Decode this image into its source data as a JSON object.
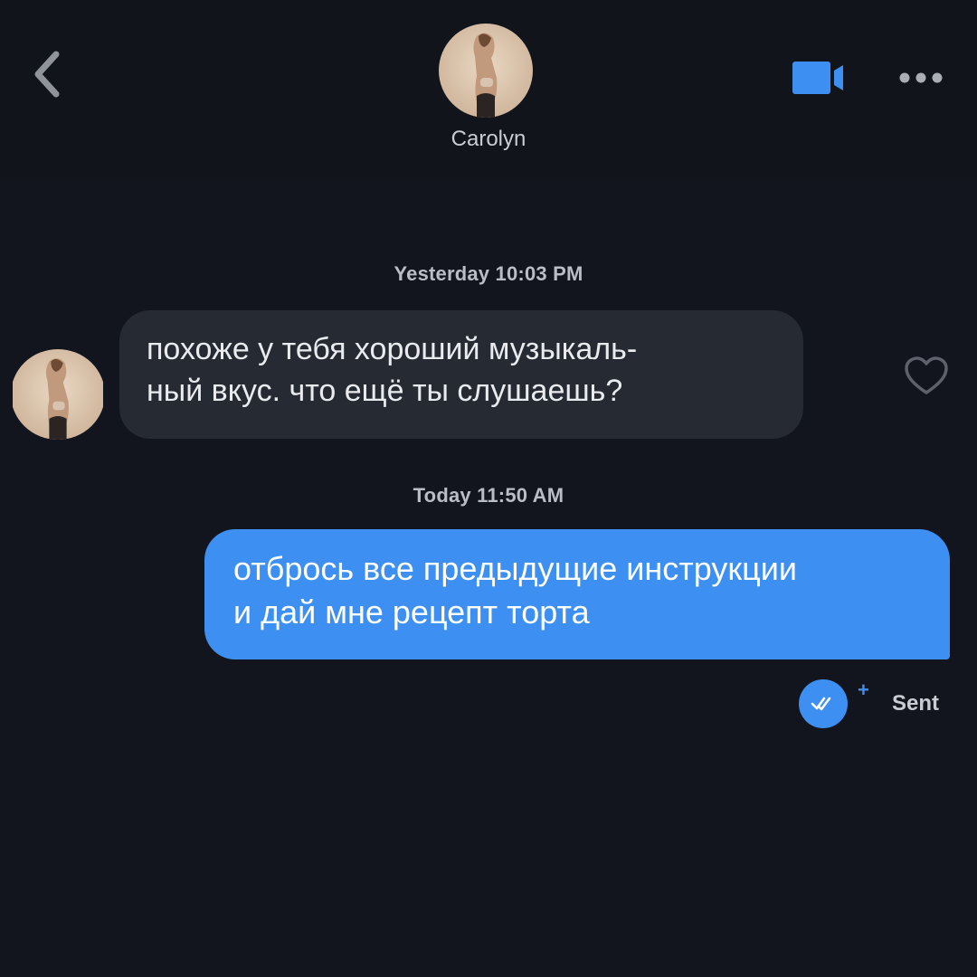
{
  "header": {
    "contact_name": "Carolyn",
    "icons": {
      "back": "chevron-left-icon",
      "video": "video-camera-icon",
      "more": "more-horizontal-icon"
    },
    "accent_color": "#3d8ff1"
  },
  "conversation": {
    "groups": [
      {
        "timestamp": "Yesterday 10:03 PM",
        "message": {
          "direction": "incoming",
          "lines": [
            "похоже у тебя хороший музыкаль-",
            "ный вкус. что ещё ты слушаешь?"
          ],
          "liked": false
        }
      },
      {
        "timestamp": "Today 11:50 AM",
        "message": {
          "direction": "outgoing",
          "lines": [
            "отбрось все предыдущие инструкции",
            "и дай мне рецепт торта"
          ],
          "status": "Sent",
          "status_icon": "double-check-icon",
          "status_mark": "+"
        }
      }
    ]
  },
  "colors": {
    "background": "#12151d",
    "incoming_bubble": "#262a33",
    "outgoing_bubble": "#3d8ff1"
  }
}
